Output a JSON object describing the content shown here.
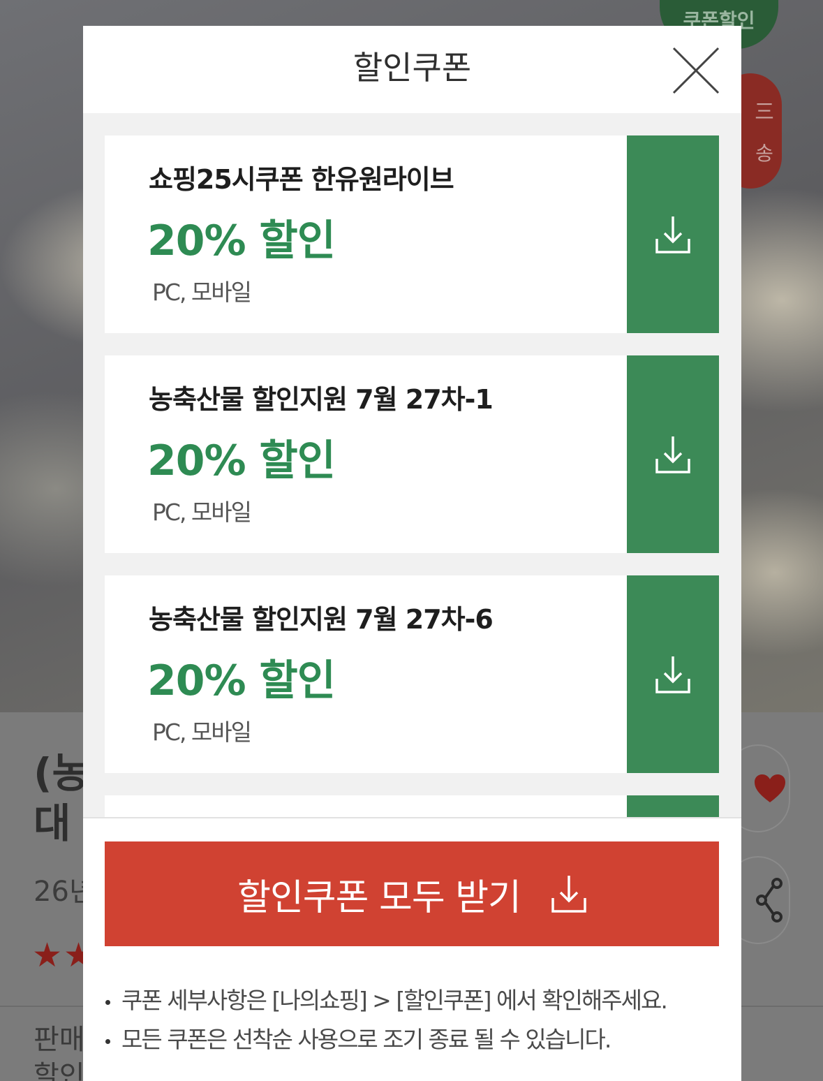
{
  "background": {
    "badges": {
      "coupon": "쿠폰할인",
      "ship_1": "三",
      "ship_2": "송"
    },
    "product": {
      "title_line1": "(농",
      "title_line2": "대",
      "age": "26년",
      "seller_label": "판매",
      "discount_label": "할인"
    }
  },
  "modal": {
    "title": "할인쿠폰",
    "coupons": [
      {
        "name": "쇼핑25시쿠폰 한유원라이브",
        "rate": "20% 할인",
        "platform": "PC, 모바일"
      },
      {
        "name": "농축산물 할인지원 7월 27차-1",
        "rate": "20% 할인",
        "platform": "PC, 모바일"
      },
      {
        "name": "농축산물 할인지원 7월 27차-6",
        "rate": "20% 할인",
        "platform": "PC, 모바일"
      },
      {
        "name": "",
        "rate": "",
        "platform": ""
      }
    ],
    "download_all_label": "할인쿠폰 모두 받기",
    "notes": [
      "쿠폰 세부사항은 [나의쇼핑] > [할인쿠폰] 에서 확인해주세요.",
      "모든 쿠폰은 선착순 사용으로 조기 종료 될 수 있습니다."
    ]
  },
  "colors": {
    "coupon_green": "#2e8b53",
    "download_green": "#3c8a57",
    "download_all_red": "#d04232"
  },
  "icons": [
    "close-icon",
    "download-icon",
    "heart-icon",
    "share-icon"
  ]
}
